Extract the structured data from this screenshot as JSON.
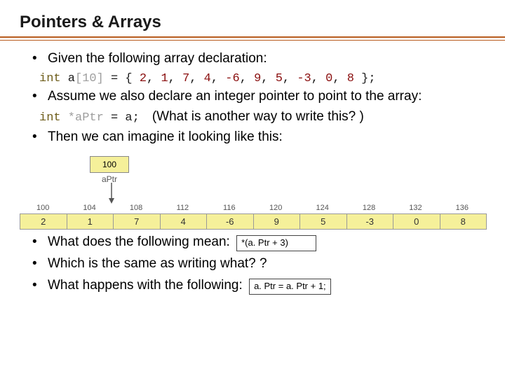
{
  "title": "Pointers & Arrays",
  "bullets1": {
    "b1": "Given the following array declaration:"
  },
  "code1": {
    "kw": "int",
    "name": " a",
    "size": "[10]",
    "eq": " = { ",
    "vals": [
      "2",
      "1",
      "7",
      "4",
      "-6",
      "9",
      "5",
      "-3",
      "0",
      "8"
    ],
    "close": " };"
  },
  "bullets2": {
    "b2": "Assume we also declare an integer pointer to point to the array:",
    "b3": "Then we can imagine it looking like this:"
  },
  "code2": {
    "kw": "int",
    "star": " *",
    "name": "aPtr",
    "rest": " = a;"
  },
  "qtext": "(What is another way to write this? )",
  "diagram": {
    "aptr_val": "100",
    "aptr_label": "aPtr",
    "addresses": [
      "100",
      "104",
      "108",
      "112",
      "116",
      "120",
      "124",
      "128",
      "132",
      "136"
    ],
    "values": [
      "2",
      "1",
      "7",
      "4",
      "-6",
      "9",
      "5",
      "-3",
      "0",
      "8"
    ]
  },
  "bullets3": {
    "b4": "What does the following mean:",
    "b5": "Which is the same as writing what? ?",
    "b6": "What happens with the following:"
  },
  "box1": "*(a. Ptr + 3)",
  "box2": "a. Ptr = a. Ptr + 1;"
}
